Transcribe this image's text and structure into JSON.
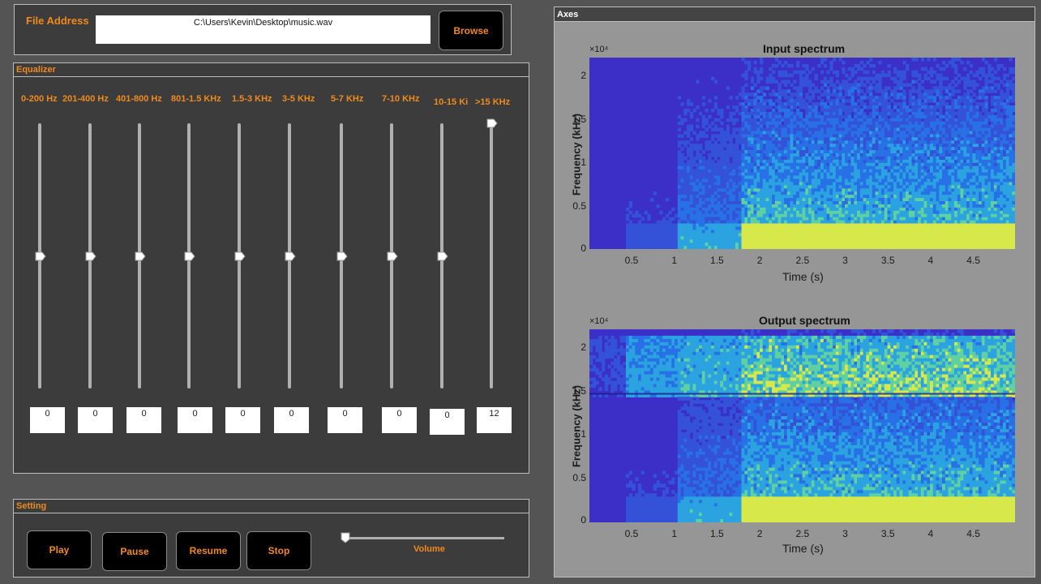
{
  "file": {
    "label": "File Address",
    "path": "C:\\Users\\Kevin\\Desktop\\music.wav",
    "browse": "Browse"
  },
  "equalizer": {
    "title": "Equalizer",
    "bands": [
      {
        "label": "0-200 Hz",
        "value": "0",
        "gain": 0
      },
      {
        "label": "201-400 Hz",
        "value": "0",
        "gain": 0
      },
      {
        "label": "401-800 Hz",
        "value": "0",
        "gain": 0
      },
      {
        "label": "801-1.5 KHz",
        "value": "0",
        "gain": 0
      },
      {
        "label": "1.5-3 KHz",
        "value": "0",
        "gain": 0
      },
      {
        "label": "3-5 KHz",
        "value": "0",
        "gain": 0
      },
      {
        "label": "5-7 KHz",
        "value": "0",
        "gain": 0
      },
      {
        "label": "7-10 KHz",
        "value": "0",
        "gain": 0
      },
      {
        "label": "10-15 Ki",
        "value": "0",
        "gain": 0
      },
      {
        "label": ">15 KHz",
        "value": "12",
        "gain": 12
      }
    ]
  },
  "setting": {
    "title": "Setting",
    "play": "Play",
    "pause": "Pause",
    "resume": "Resume",
    "stop": "Stop",
    "volume_label": "Volume",
    "volume": 0
  },
  "axes": {
    "title": "Axes",
    "charts": {
      "input": {
        "title": "Input spectrum",
        "multiplier": "×10⁴",
        "ylabel": "Frequency (kHz)",
        "xlabel": "Time (s)",
        "yticks": [
          "2",
          "1.5",
          "1",
          "0.5",
          "0"
        ],
        "xticks": [
          "0.5",
          "1",
          "1.5",
          "2",
          "2.5",
          "3",
          "3.5",
          "4",
          "4.5"
        ]
      },
      "output": {
        "title": "Output spectrum",
        "multiplier": "×10⁴",
        "ylabel": "Frequency (kHz)",
        "xlabel": "Time (s)",
        "yticks": [
          "2",
          "1.5",
          "1",
          "0.5",
          "0"
        ],
        "xticks": [
          "0.5",
          "1",
          "1.5",
          "2",
          "2.5",
          "3",
          "3.5",
          "4",
          "4.5"
        ]
      }
    }
  },
  "colors": {
    "accent": "#f08a1c",
    "spectrogram_bg": "#3b2fc7",
    "spectrogram_mid": "#2a7de6",
    "spectrogram_hot": "#7fe06a"
  }
}
